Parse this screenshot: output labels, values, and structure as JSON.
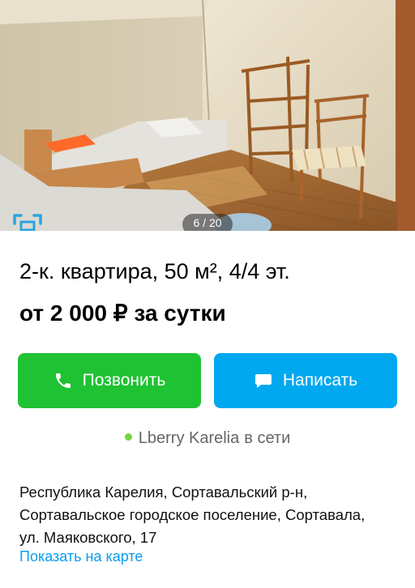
{
  "photo": {
    "counter": "6 / 20",
    "gallery_icon": "fullscreen-icon"
  },
  "listing": {
    "title": "2-к. квартира, 50 м², 4/4 эт.",
    "price": "от 2 000 ₽ за сутки"
  },
  "actions": {
    "call_label": "Позвонить",
    "call_icon": "phone-icon",
    "write_label": "Написать",
    "write_icon": "chat-bubble-icon"
  },
  "seller": {
    "name": "Lberry Karelia",
    "status": "в сети"
  },
  "address": {
    "lines": [
      "Республика Карелия, Сортавальский р-н,",
      "Сортавальское городское поселение, Сортавала,",
      "ул. Маяковского, 17"
    ],
    "map_link": "Показать на карте"
  },
  "colors": {
    "call_button": "#1fc232",
    "write_button": "#00a8f0",
    "online_dot": "#75d243",
    "link": "#0a9cf0"
  }
}
